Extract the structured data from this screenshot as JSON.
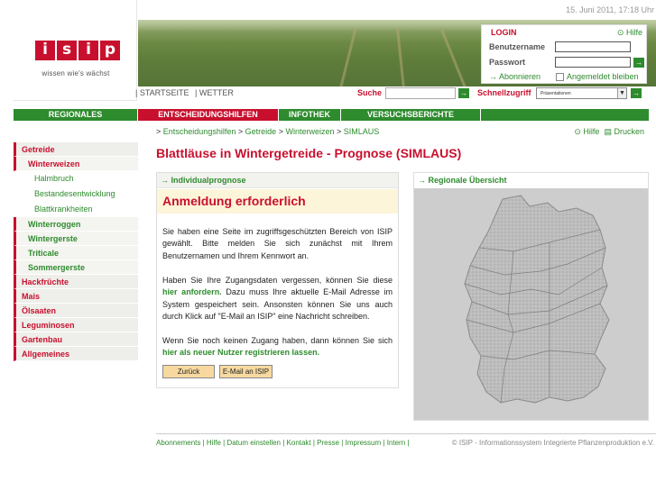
{
  "date": "15. Juni 2011, 17:18 Uhr",
  "logo": {
    "letters": [
      "i",
      "s",
      "i",
      "p"
    ],
    "tagline": "wissen wie's wächst"
  },
  "login": {
    "title": "LOGIN",
    "help": "Hilfe",
    "username_label": "Benutzername",
    "password_label": "Passwort",
    "subscribe": "Abonnieren",
    "remember": "Angemeldet bleiben",
    "go_label": "→"
  },
  "toplinks": [
    "| STARTSEITE",
    "| WETTER"
  ],
  "search": {
    "label": "Suche",
    "quick_label": "Schnellzugriff",
    "quick_value": "Präsentationen",
    "go_label": "→"
  },
  "nav": [
    "REGIONALES",
    "ENTSCHEIDUNGSHILFEN",
    "INFOTHEK",
    "VERSUCHSBERICHTE",
    ""
  ],
  "breadcrumb": [
    "Entscheidungshilfen",
    "Getreide",
    "Winterweizen",
    "SIMLAUS"
  ],
  "breadcrumb_prefix": ">",
  "breadcrumb_sep": ">",
  "util": {
    "help": "Hilfe",
    "print": "Drucken"
  },
  "sidebar": [
    {
      "label": "Getreide",
      "level": 1
    },
    {
      "label": "Winterweizen",
      "level": 2,
      "active": true
    },
    {
      "label": "Halmbruch",
      "level": 3
    },
    {
      "label": "Bestandesentwicklung",
      "level": 3
    },
    {
      "label": "Blattkrankheiten",
      "level": 3
    },
    {
      "label": "Winterroggen",
      "level": 2
    },
    {
      "label": "Wintergerste",
      "level": 2
    },
    {
      "label": "Triticale",
      "level": 2
    },
    {
      "label": "Sommergerste",
      "level": 2
    },
    {
      "label": "Hackfrüchte",
      "level": 1
    },
    {
      "label": "Mais",
      "level": 1
    },
    {
      "label": "Ölsaaten",
      "level": 1
    },
    {
      "label": "Leguminosen",
      "level": 1
    },
    {
      "label": "Gartenbau",
      "level": 1
    },
    {
      "label": "Allgemeines",
      "level": 1
    }
  ],
  "page_title": "Blattläuse in Wintergetreide - Prognose (SIMLAUS)",
  "left_panel": {
    "head": "Individualprognose",
    "alert_title": "Anmeldung erforderlich",
    "p1": "Sie haben eine Seite im zugriffsgeschützten Bereich von ISIP gewählt. Bitte melden Sie sich zunächst mit Ihrem Benutzernamen und Ihrem Kennwort an.",
    "p2_pre": "Haben Sie Ihre Zugangsdaten vergessen, können Sie diese",
    "p2_link": "hier anfordern.",
    "p2_post": "Dazu muss Ihre aktuelle E-Mail Adresse im System gespeichert sein. Ansonsten können Sie uns auch durch Klick auf \"E-Mail an ISIP\" eine Nachricht schreiben.",
    "p3_pre": "Wenn Sie noch keinen Zugang haben, dann können Sie sich",
    "p3_link": "hier als neuer Nutzer registrieren lassen.",
    "back_button": "Zurück",
    "mail_button": "E-Mail an ISIP"
  },
  "right_panel": {
    "head": "Regionale Übersicht"
  },
  "footer": {
    "links": "Abonnements | Hilfe | Datum einstellen | Kontakt | Presse | Impressum | Intern |",
    "copyright": "© ISIP - Informationssystem Integrierte Pflanzenproduktion e.V."
  },
  "colors": {
    "brand_red": "#c8102e",
    "brand_green": "#2e8b2e"
  }
}
